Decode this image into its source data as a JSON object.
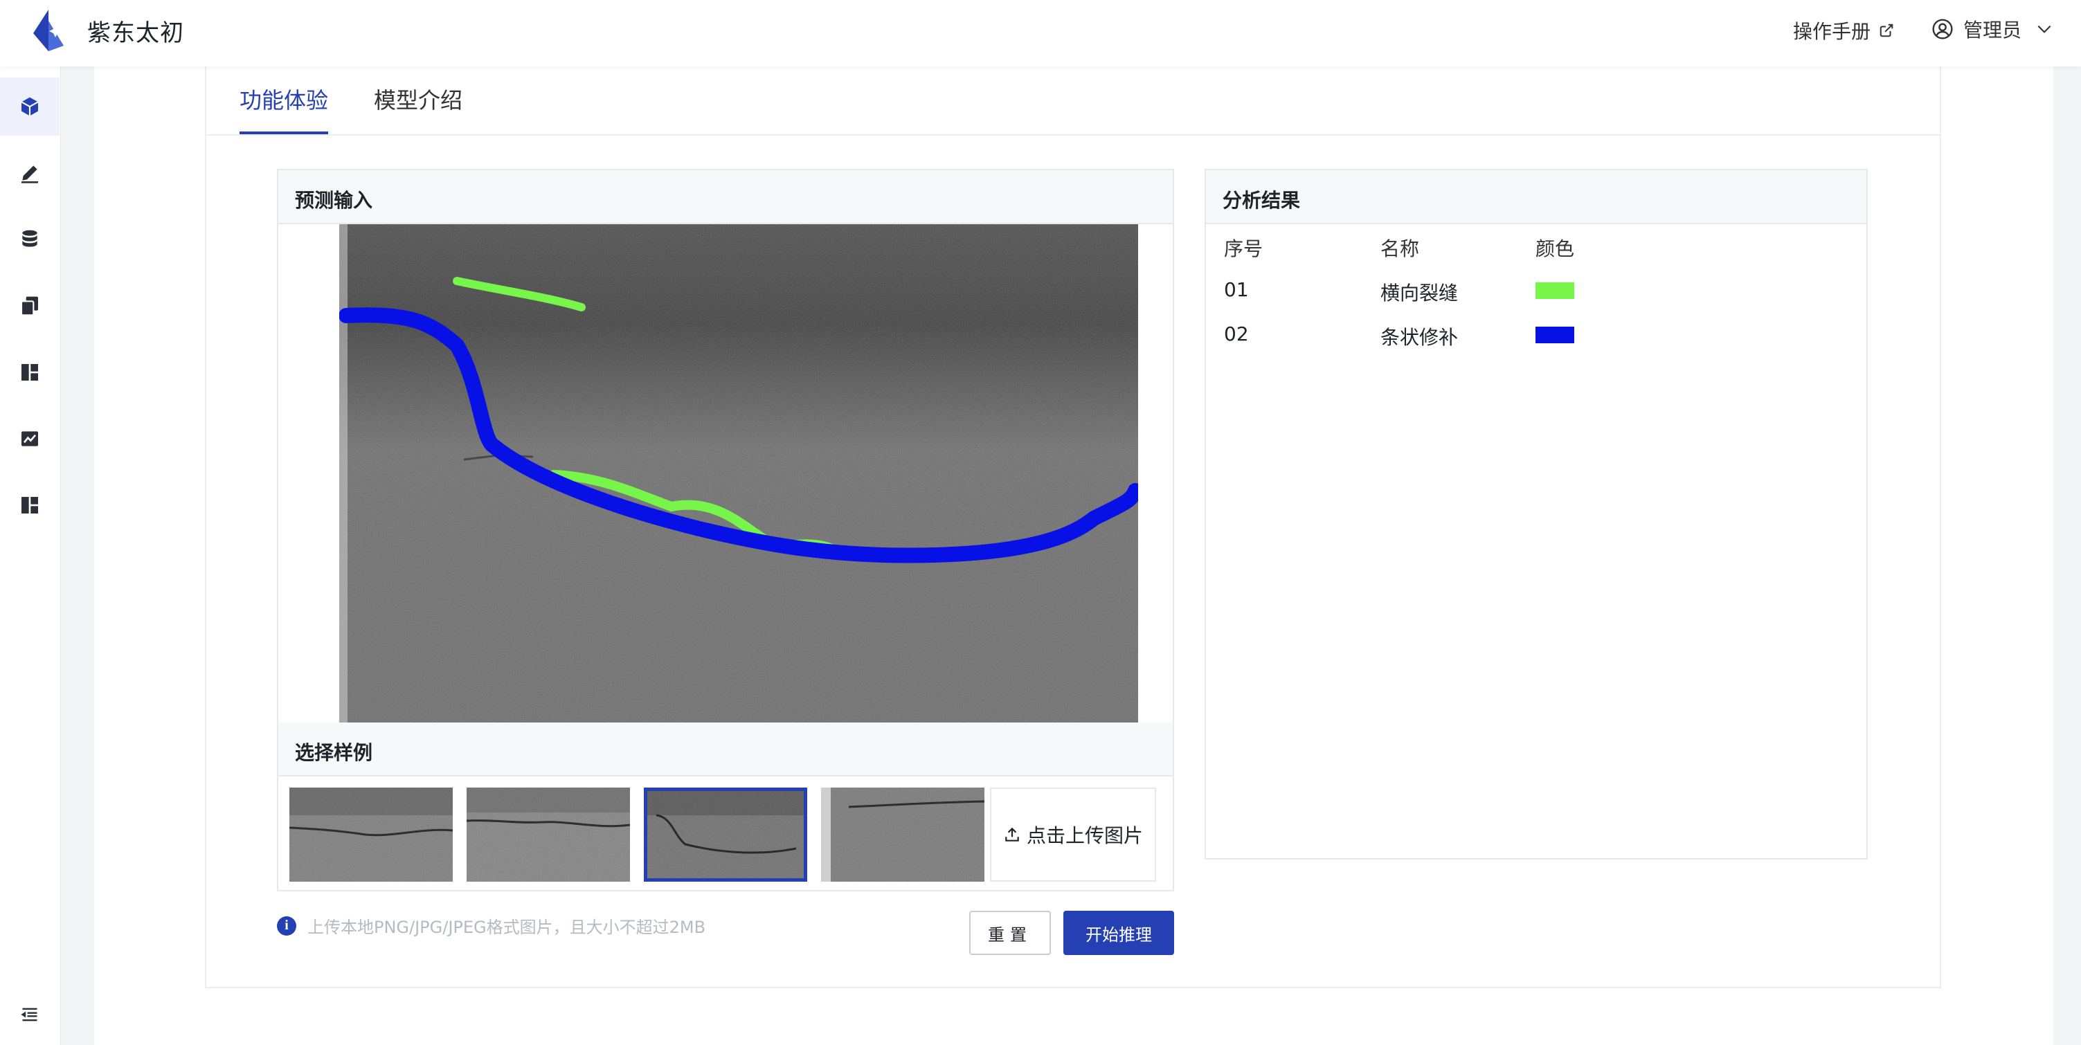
{
  "header": {
    "app_title": "紫东太初",
    "manual_label": "操作手册",
    "user_label": "管理员"
  },
  "sidebar": {
    "items": [
      {
        "icon": "cube-icon",
        "active": true
      },
      {
        "icon": "pencil-icon",
        "active": false
      },
      {
        "icon": "database-icon",
        "active": false
      },
      {
        "icon": "copy-icon",
        "active": false
      },
      {
        "icon": "dashboard-icon",
        "active": false
      },
      {
        "icon": "chart-icon",
        "active": false
      },
      {
        "icon": "layout-icon",
        "active": false
      }
    ],
    "bottom_icon": "collapse-menu-icon"
  },
  "tabs": [
    {
      "label": "功能体验",
      "active": true
    },
    {
      "label": "模型介绍",
      "active": false
    }
  ],
  "predict": {
    "title": "预测输入",
    "sample_title": "选择样例",
    "selected_sample": 3,
    "upload_label": "点击上传图片",
    "hint": "上传本地PNG/JPG/JPEG格式图片，且大小不超过2MB",
    "reset_label": "重置",
    "run_label": "开始推理"
  },
  "result": {
    "title": "分析结果",
    "columns": [
      "序号",
      "名称",
      "颜色"
    ],
    "rows": [
      {
        "index": "01",
        "name": "横向裂缝",
        "color": "#77f54a"
      },
      {
        "index": "02",
        "name": "条状修补",
        "color": "#0711e6"
      }
    ]
  },
  "colors": {
    "accent": "#2440b3",
    "crack": "#77f54a",
    "patch": "#0711e6"
  }
}
